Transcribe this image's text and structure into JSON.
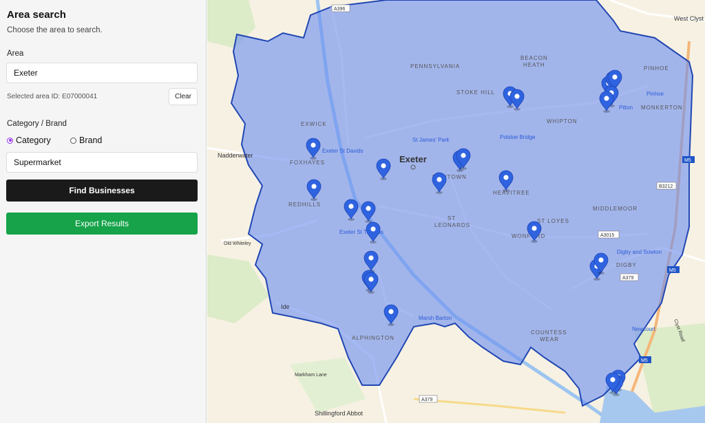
{
  "sidebar": {
    "title": "Area search",
    "subtitle": "Choose the area to search.",
    "area_label": "Area",
    "area_value": "Exeter",
    "selected_area_text": "Selected area ID: E07000041",
    "clear_label": "Clear",
    "category_brand_label": "Category / Brand",
    "radio_category": "Category",
    "radio_brand": "Brand",
    "selected_mode": "category",
    "category_value": "Supermarket",
    "find_label": "Find Businesses",
    "export_label": "Export Results"
  },
  "map": {
    "city_label": "Exeter",
    "areas": [
      "PENNSYLVANIA",
      "BEACON",
      "HEATH",
      "PINHOE",
      "STOKE HILL",
      "MONKERTON",
      "WHIPTON",
      "EXWICK",
      "FOXHAYES",
      "NEWTOWN",
      "HEAVITREE",
      "REDHILLS",
      "ST",
      "LEONARDS",
      "ST LOYES",
      "MIDDLEMOOR",
      "WONFORD",
      "DIGBY",
      "ALPHINGTON",
      "COUNTESS",
      "WEAR"
    ],
    "places": [
      "West Clyst",
      "Nadderwater",
      "Old Whiteley",
      "Ide",
      "Markham Lane",
      "Shillingford Abbot"
    ],
    "stations": [
      "Exeter St Davids",
      "St James' Park",
      "Polsloe Bridge",
      "Pinhoe",
      "Pilton",
      "Exeter St Thomas",
      "Digby and Sowton",
      "Marsh Barton",
      "Newcourt"
    ],
    "roads": [
      "A396",
      "A3015",
      "A379",
      "B3212",
      "M5",
      "Clyst Road"
    ],
    "marker_count": 30,
    "colors": {
      "area_fill": "#6d8ff0",
      "area_border": "#2046b3",
      "marker": "#2f63e0",
      "find_button": "#1a1a1a",
      "export_button": "#16a34a",
      "radio_accent": "#9333ea"
    }
  }
}
